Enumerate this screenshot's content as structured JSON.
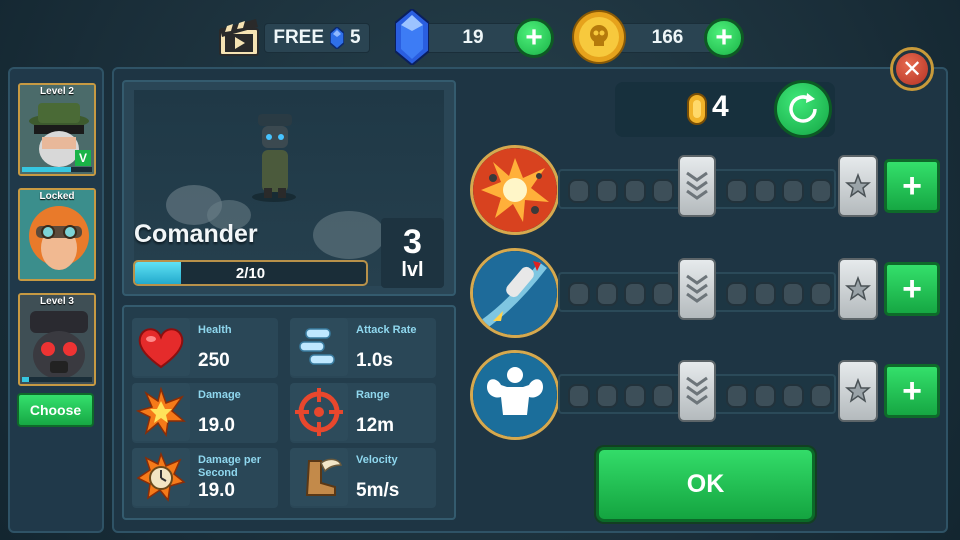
{
  "top_bar": {
    "free_label": "FREE",
    "free_gems": "5",
    "gems": "19",
    "coins": "166"
  },
  "heroes": [
    {
      "label": "Level 2",
      "xp_fraction": 0.7,
      "equipped": true
    },
    {
      "label": "Locked"
    },
    {
      "label": "Level 3",
      "xp_fraction": 0.1
    }
  ],
  "choose_label": "Choose",
  "hero": {
    "name": "Comander",
    "xp_text": "2/10",
    "xp_fraction": 0.2,
    "level": "3",
    "level_unit": "lvl"
  },
  "stats": [
    {
      "label": "Health",
      "value": "250",
      "icon": "heart-icon"
    },
    {
      "label": "Attack Rate",
      "value": "1.0s",
      "icon": "bullets-icon"
    },
    {
      "label": "Damage",
      "value": "19.0",
      "icon": "explosion-icon"
    },
    {
      "label": "Range",
      "value": "12m",
      "icon": "crosshair-icon"
    },
    {
      "label": "Damage per Second",
      "value": "19.0",
      "icon": "stopwatch-icon"
    },
    {
      "label": "Velocity",
      "value": "5m/s",
      "icon": "winged-boot-icon"
    }
  ],
  "upgrades": {
    "tokens": "4",
    "rows": [
      {
        "icon": "explosion-upgrade-icon"
      },
      {
        "icon": "rocket-upgrade-icon"
      },
      {
        "icon": "muscle-upgrade-icon"
      }
    ]
  },
  "ok_label": "OK",
  "colors": {
    "accent_green": "#1ab347",
    "gold_border": "#c89a3a",
    "panel_bg": "#1e3544"
  }
}
